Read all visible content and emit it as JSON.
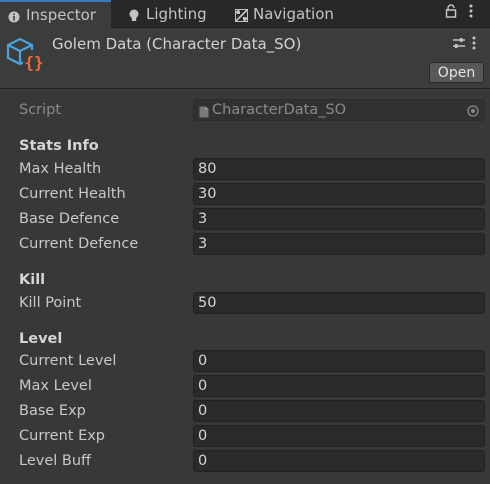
{
  "tabs": [
    {
      "label": "Inspector",
      "icon": "info-icon",
      "active": true
    },
    {
      "label": "Lighting",
      "icon": "bulb-icon",
      "active": false
    },
    {
      "label": "Navigation",
      "icon": "navigation-icon",
      "active": false
    }
  ],
  "header": {
    "title": "Golem Data (Character Data_SO)",
    "open_label": "Open"
  },
  "script_row": {
    "label": "Script",
    "value": "CharacterData_SO"
  },
  "sections": {
    "stats": {
      "heading": "Stats Info",
      "max_health": {
        "label": "Max Health",
        "value": "80"
      },
      "current_health": {
        "label": "Current Health",
        "value": "30"
      },
      "base_defence": {
        "label": "Base Defence",
        "value": "3"
      },
      "current_defence": {
        "label": "Current Defence",
        "value": "3"
      }
    },
    "kill": {
      "heading": "Kill",
      "kill_point": {
        "label": "Kill Point",
        "value": "50"
      }
    },
    "level": {
      "heading": "Level",
      "current_level": {
        "label": "Current Level",
        "value": "0"
      },
      "max_level": {
        "label": "Max Level",
        "value": "0"
      },
      "base_exp": {
        "label": "Base Exp",
        "value": "0"
      },
      "current_exp": {
        "label": "Current Exp",
        "value": "0"
      },
      "level_buff": {
        "label": "Level Buff",
        "value": "0"
      }
    }
  },
  "colors": {
    "accent": "#3a79bb",
    "panel": "#383838",
    "field": "#2a2a2a",
    "icon_blue": "#4aa3df",
    "icon_orange": "#f26b3a"
  }
}
